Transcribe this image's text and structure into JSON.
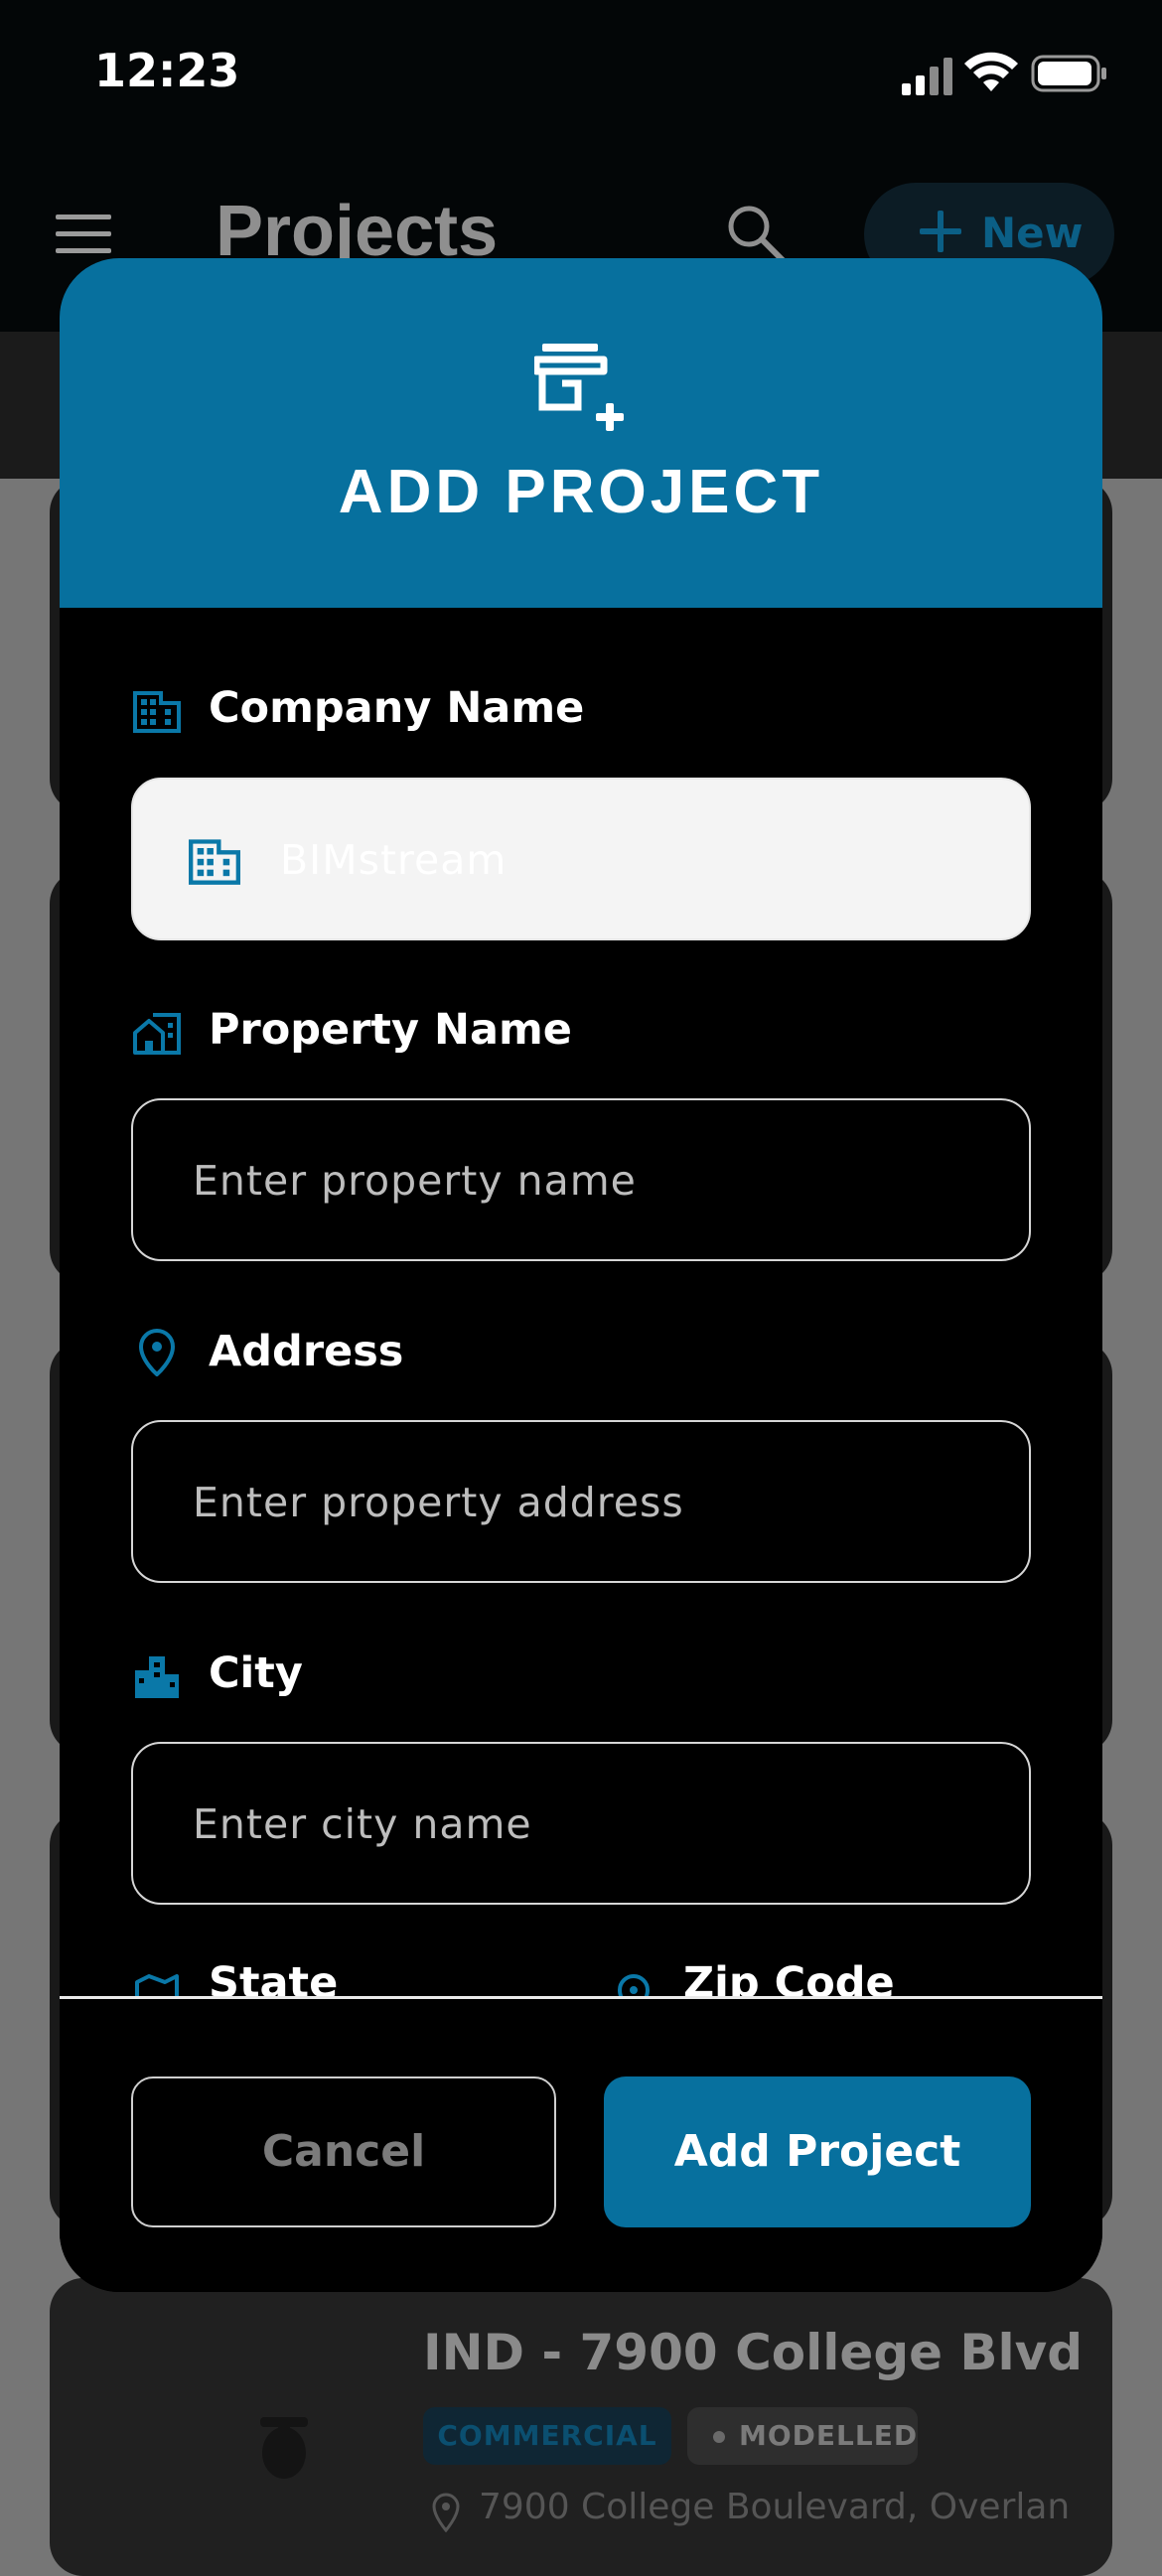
{
  "status_bar": {
    "time": "12:23"
  },
  "app_bar": {
    "title": "Projects",
    "new_button_label": "New"
  },
  "background_card": {
    "title": "IND - 7900 College Blvd",
    "tags": [
      "COMMERCIAL",
      "MODELLED"
    ],
    "address": "7900 College Boulevard, Overlan"
  },
  "modal": {
    "title": "ADD PROJECT",
    "fields": [
      {
        "label": "Company Name",
        "value": "BIMstream",
        "placeholder": "",
        "icon": "building-icon",
        "disabled": true
      },
      {
        "label": "Property Name",
        "value": "",
        "placeholder": "Enter property name",
        "icon": "house-building-icon"
      },
      {
        "label": "Address",
        "value": "",
        "placeholder": "Enter property address",
        "icon": "location-pin-icon"
      },
      {
        "label": "City",
        "value": "",
        "placeholder": "Enter city name",
        "icon": "city-icon"
      }
    ],
    "partial_fields": [
      {
        "label": "State",
        "icon": "map-icon"
      },
      {
        "label": "Zip Code",
        "icon": "location-pin-icon"
      }
    ],
    "cancel_label": "Cancel",
    "submit_label": "Add Project"
  },
  "colors": {
    "accent": "#07709e",
    "backdrop": "#767676",
    "modal_background": "#000000"
  }
}
